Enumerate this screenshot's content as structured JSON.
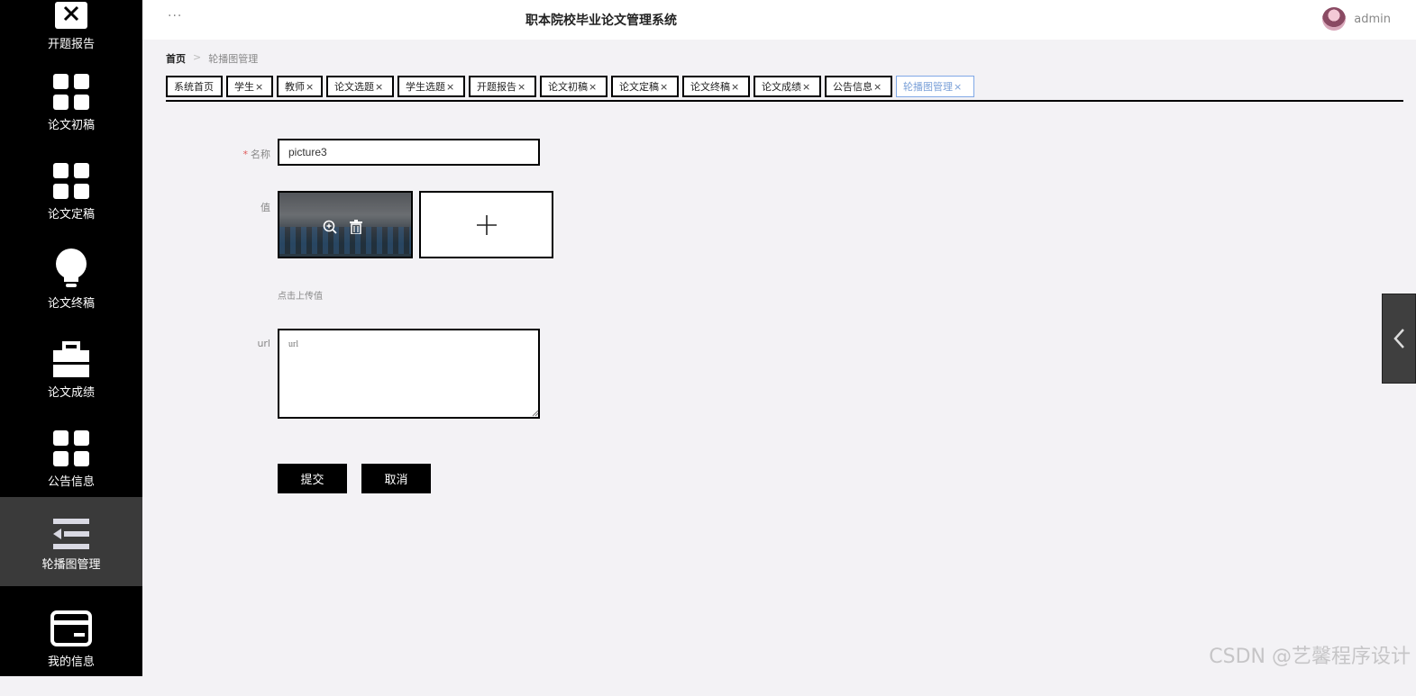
{
  "header": {
    "dots": "···",
    "title": "职本院校毕业论文管理系统",
    "user": "admin"
  },
  "sidebar": {
    "items": [
      {
        "label": "开题报告",
        "icon": "close-icon"
      },
      {
        "label": "论文初稿",
        "icon": "grid-icon"
      },
      {
        "label": "论文定稿",
        "icon": "grid-icon"
      },
      {
        "label": "论文终稿",
        "icon": "bulb-icon"
      },
      {
        "label": "论文成绩",
        "icon": "briefcase-icon"
      },
      {
        "label": "公告信息",
        "icon": "grid-icon"
      },
      {
        "label": "轮播图管理",
        "icon": "menu-fold-icon"
      },
      {
        "label": "我的信息",
        "icon": "card-icon"
      }
    ]
  },
  "breadcrumb": {
    "home": "首页",
    "separator": ">",
    "current": "轮播图管理"
  },
  "tabs": [
    {
      "label": "系统首页",
      "closable": false
    },
    {
      "label": "学生",
      "closable": true
    },
    {
      "label": "教师",
      "closable": true
    },
    {
      "label": "论文选题",
      "closable": true
    },
    {
      "label": "学生选题",
      "closable": true
    },
    {
      "label": "开题报告",
      "closable": true
    },
    {
      "label": "论文初稿",
      "closable": true
    },
    {
      "label": "论文定稿",
      "closable": true
    },
    {
      "label": "论文终稿",
      "closable": true
    },
    {
      "label": "论文成绩",
      "closable": true
    },
    {
      "label": "公告信息",
      "closable": true
    },
    {
      "label": "轮播图管理",
      "closable": true,
      "active": true
    }
  ],
  "close_glyph": "×",
  "form": {
    "name_label": "名称",
    "required_mark": "*",
    "name_value": "picture3",
    "value_label": "值",
    "upload_hint": "点击上传值",
    "url_label": "url",
    "url_placeholder": "url",
    "submit": "提交",
    "cancel": "取消"
  },
  "watermark": "CSDN @艺馨程序设计",
  "colors": {
    "sidebar_bg": "#000000",
    "sidebar_active": "#3a3a3a",
    "page_bg": "#f3f2f5",
    "active_tab": "#7aa0d8",
    "required": "#e05a5a"
  }
}
